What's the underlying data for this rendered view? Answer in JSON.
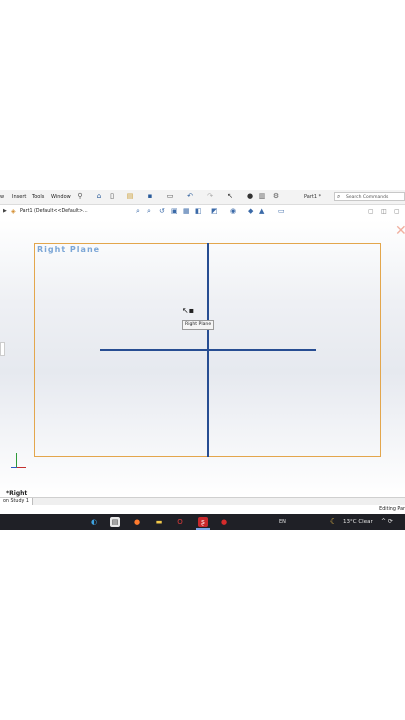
{
  "menu": {
    "items": [
      "w",
      "Insert",
      "Tools",
      "Window"
    ]
  },
  "toolbar": {
    "icons": [
      "pin-icon",
      "home-icon",
      "new-document-icon",
      "open-icon",
      "save-icon",
      "print-icon",
      "undo-icon",
      "redo-icon",
      "select-icon",
      "traffic-light-icon",
      "file-properties-icon",
      "options-icon"
    ]
  },
  "document": {
    "title": "Part1 *"
  },
  "search": {
    "placeholder": "Search Commands"
  },
  "tree": {
    "part_label": "Part1 (Default<<Default>..."
  },
  "viewport": {
    "plane_label": "Right Plane",
    "tooltip": "Right Plane",
    "view_name": "*Right",
    "plane_color": "#e3a64c",
    "axis_color": "#274d92"
  },
  "tabs": {
    "study": "on Study 1"
  },
  "status": {
    "text": "Editing Par"
  },
  "taskbar": {
    "language": "EN",
    "weather": "13°C  Clear",
    "tray": "^ ⟳"
  }
}
